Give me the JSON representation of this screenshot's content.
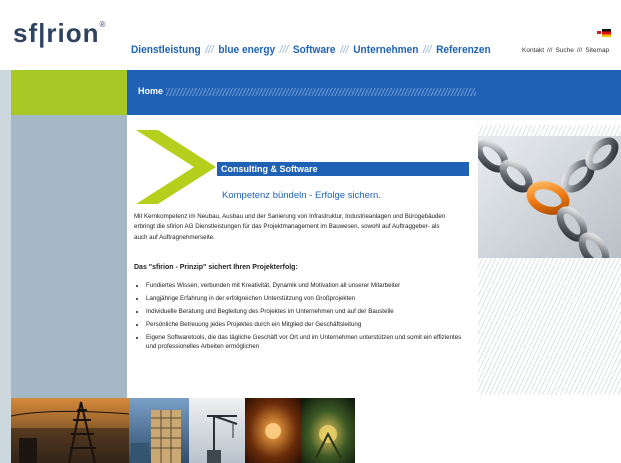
{
  "logo": {
    "text": "sf|rion",
    "reg": "®"
  },
  "main_nav": {
    "items": [
      "Dienstleistung",
      "blue energy",
      "Software",
      "Unternehmen",
      "Referenzen"
    ],
    "separator": "///"
  },
  "meta_nav": {
    "items": [
      "Kontakt",
      "Suche",
      "Sitemap"
    ],
    "separator": "///"
  },
  "breadcrumb": {
    "home": "Home"
  },
  "content": {
    "section_title": "Consulting & Software",
    "tagline": "Kompetenz bündeln - Erfolge sichern.",
    "intro": "Mit Kernkompetenz im Neubau, Ausbau und der Sanierung von Infrastruktur, Industrieanlagen und Bürogebäuden erbringt die sfirion AG Dienstleistungen für das Projektmanagement im Bauwesen, sowohl auf Auftraggeber- als auch auf Auftragnehmerseite.",
    "principle_heading": "Das \"sfirion - Prinzip\" sichert Ihren Projekterfolg:",
    "bullets": [
      "Fundiertes Wissen, verbunden mit Kreativität, Dynamik und Motivation all unserer Mitarbeiter",
      "Langjährige Erfahrung in der erfolgreichen Unterstützung von Großprojekten",
      "Individuelle Beratung und Begleitung des Projektes im Unternehmen und auf der Baustelle",
      "Persönliche Betreuung jedes Projektes durch ein Mitglied der Geschäftsleitung",
      "Eigene Softwaretools, die das tägliche Geschäft vor Ort und im Unternehmen unterstützen und somit ein effizientes und professionelles Arbeiten ermöglichen"
    ]
  },
  "colors": {
    "brand_blue": "#1f61b5",
    "brand_green": "#a8c825",
    "sidebar_gray": "#a5b8c6",
    "logo_navy": "#2e4360"
  },
  "icons": {
    "language_flags": [
      "german-flag-icon",
      "uk-flag-icon"
    ],
    "chevron": "green-chevron-graphic"
  }
}
